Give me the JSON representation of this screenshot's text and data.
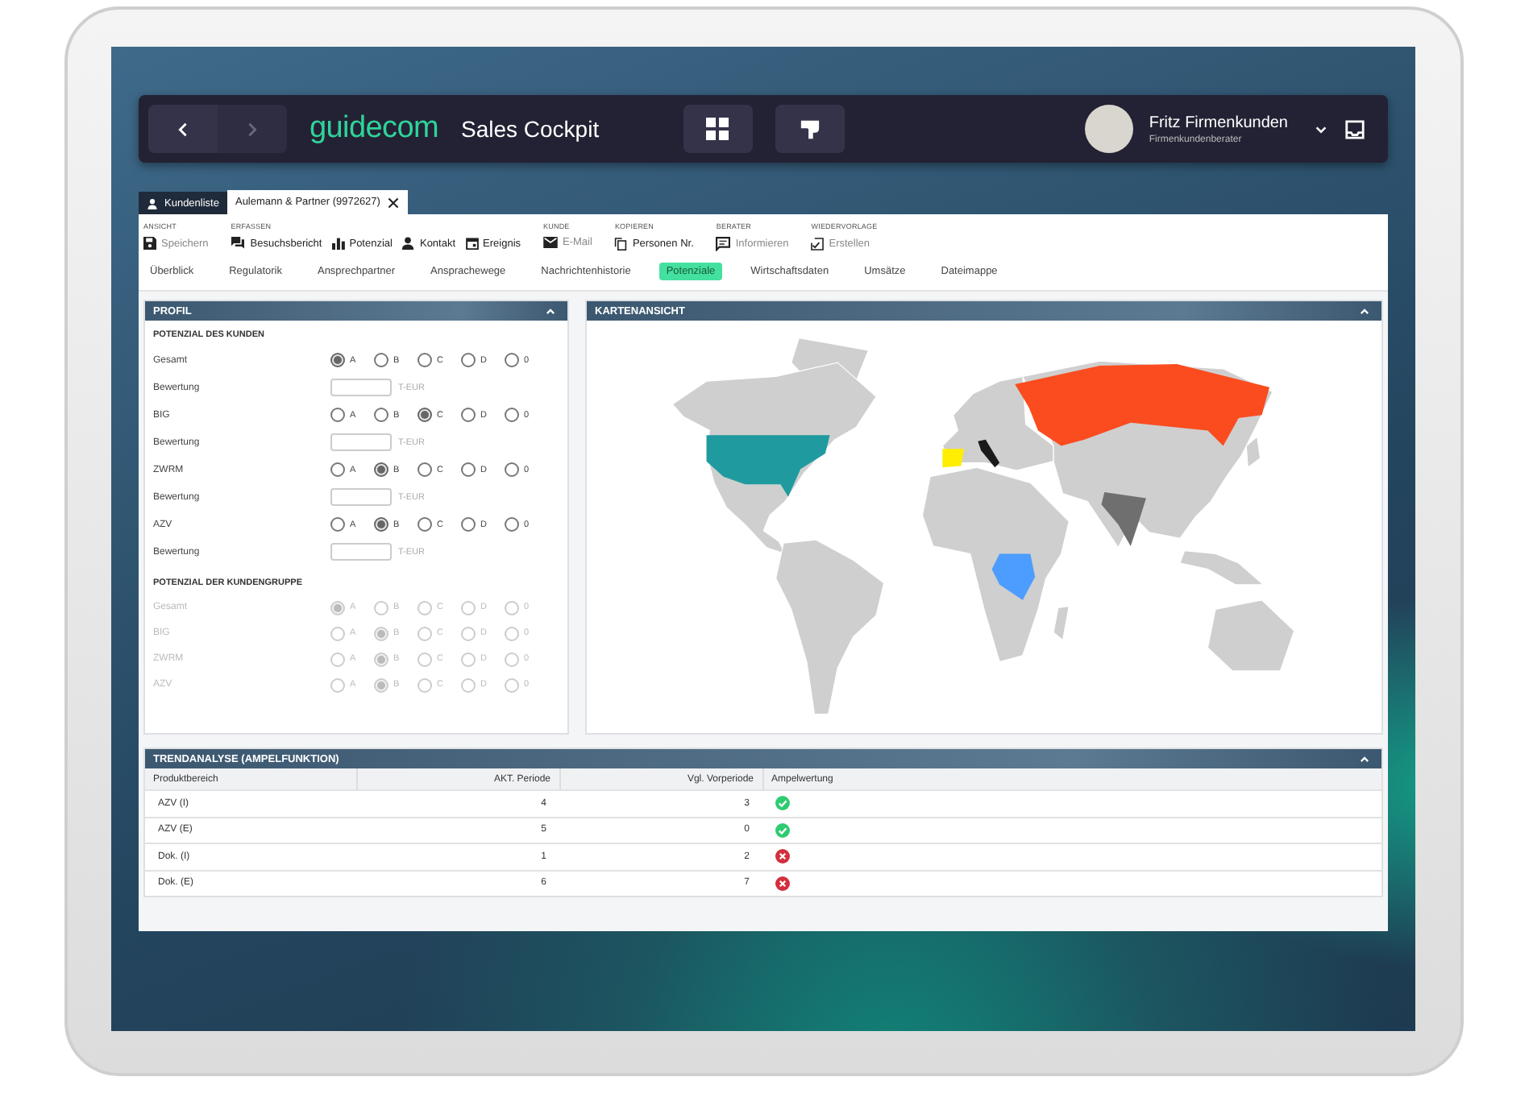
{
  "header": {
    "app_name": "guidecom",
    "app_title": "Sales Cockpit",
    "user": {
      "name": "Fritz Firmenkunden",
      "role": "Firmenkundenberater"
    }
  },
  "document_tabs": [
    {
      "label": "Kundenliste",
      "selected": false,
      "kind": "list"
    },
    {
      "label": "Aulemann & Partner (9972627)",
      "selected": true,
      "kind": "record"
    }
  ],
  "toolbar": [
    {
      "heading": "ANSICHT",
      "actions": [
        {
          "label": "Speichern",
          "disabled": true
        }
      ]
    },
    {
      "heading": "ERFASSEN",
      "actions": [
        {
          "label": "Besuchsbericht",
          "disabled": false
        },
        {
          "label": "Potenzial",
          "disabled": false
        },
        {
          "label": "Kontakt",
          "disabled": false
        },
        {
          "label": "Ereignis",
          "disabled": false
        }
      ]
    },
    {
      "heading": "KUNDE",
      "actions": [
        {
          "label": "E-Mail",
          "disabled": true
        }
      ]
    },
    {
      "heading": "KOPIEREN",
      "actions": [
        {
          "label": "Personen Nr.",
          "disabled": false
        }
      ]
    },
    {
      "heading": "BERATER",
      "actions": [
        {
          "label": "Informieren",
          "disabled": true
        }
      ]
    },
    {
      "heading": "WIEDERVORLAGE",
      "actions": [
        {
          "label": "Erstellen",
          "disabled": true
        }
      ]
    }
  ],
  "nav_tabs": [
    {
      "label": "Überblick",
      "selected": false
    },
    {
      "label": "Regulatorik",
      "selected": false
    },
    {
      "label": "Ansprechpartner",
      "selected": false
    },
    {
      "label": "Ansprachewege",
      "selected": false
    },
    {
      "label": "Nachrichtenhistorie",
      "selected": false
    },
    {
      "label": "Potenziale",
      "selected": true
    },
    {
      "label": "Wirtschaftsdaten",
      "selected": false
    },
    {
      "label": "Umsätze",
      "selected": false
    },
    {
      "label": "Dateimappe",
      "selected": false
    }
  ],
  "profile_panel": {
    "title": "PROFIL",
    "sections": [
      {
        "heading": "POTENZIAL DES KUNDEN",
        "disabled": false,
        "rows": [
          {
            "kind": "radio",
            "label": "Gesamt",
            "options": [
              {
                "label": "A",
                "selected": true
              },
              {
                "label": "B",
                "selected": false
              },
              {
                "label": "C",
                "selected": false
              },
              {
                "label": "D",
                "selected": false
              },
              {
                "label": "0",
                "selected": false
              }
            ]
          },
          {
            "kind": "amount",
            "label": "Bewertung",
            "unit": "T-EUR"
          },
          {
            "kind": "radio",
            "label": "BIG",
            "options": [
              {
                "label": "A",
                "selected": false
              },
              {
                "label": "B",
                "selected": false
              },
              {
                "label": "C",
                "selected": true
              },
              {
                "label": "D",
                "selected": false
              },
              {
                "label": "0",
                "selected": false
              }
            ]
          },
          {
            "kind": "amount",
            "label": "Bewertung",
            "unit": "T-EUR"
          },
          {
            "kind": "radio",
            "label": "ZWRM",
            "options": [
              {
                "label": "A",
                "selected": false
              },
              {
                "label": "B",
                "selected": true
              },
              {
                "label": "C",
                "selected": false
              },
              {
                "label": "D",
                "selected": false
              },
              {
                "label": "0",
                "selected": false
              }
            ]
          },
          {
            "kind": "amount",
            "label": "Bewertung",
            "unit": "T-EUR"
          },
          {
            "kind": "radio",
            "label": "AZV",
            "options": [
              {
                "label": "A",
                "selected": false
              },
              {
                "label": "B",
                "selected": true
              },
              {
                "label": "C",
                "selected": false
              },
              {
                "label": "D",
                "selected": false
              },
              {
                "label": "0",
                "selected": false
              }
            ]
          },
          {
            "kind": "amount",
            "label": "Bewertung",
            "unit": "T-EUR"
          }
        ]
      },
      {
        "heading": "POTENZIAL DER KUNDENGRUPPE",
        "disabled": true,
        "rows": [
          {
            "kind": "radio",
            "label": "Gesamt",
            "options": [
              {
                "label": "A",
                "selected": true
              },
              {
                "label": "B",
                "selected": false
              },
              {
                "label": "C",
                "selected": false
              },
              {
                "label": "D",
                "selected": false
              },
              {
                "label": "0",
                "selected": false
              }
            ]
          },
          {
            "kind": "radio",
            "label": "BIG",
            "options": [
              {
                "label": "A",
                "selected": false
              },
              {
                "label": "B",
                "selected": true
              },
              {
                "label": "C",
                "selected": false
              },
              {
                "label": "D",
                "selected": false
              },
              {
                "label": "0",
                "selected": false
              }
            ]
          },
          {
            "kind": "radio",
            "label": "ZWRM",
            "options": [
              {
                "label": "A",
                "selected": false
              },
              {
                "label": "B",
                "selected": true
              },
              {
                "label": "C",
                "selected": false
              },
              {
                "label": "D",
                "selected": false
              },
              {
                "label": "0",
                "selected": false
              }
            ]
          },
          {
            "kind": "radio",
            "label": "AZV",
            "options": [
              {
                "label": "A",
                "selected": false
              },
              {
                "label": "B",
                "selected": true
              },
              {
                "label": "C",
                "selected": false
              },
              {
                "label": "D",
                "selected": false
              },
              {
                "label": "0",
                "selected": false
              }
            ]
          }
        ]
      }
    ]
  },
  "map_panel": {
    "title": "KARTENANSICHT"
  },
  "trend_panel": {
    "title": "TRENDANALYSE (AMPELFUNKTION)",
    "columns": [
      "Produktbereich",
      "AKT. Periode",
      "Vgl. Vorperiode",
      "Ampelwertung"
    ],
    "rows": [
      {
        "cells": [
          "AZV (I)",
          "4",
          "3"
        ],
        "kind": "positive"
      },
      {
        "cells": [
          "AZV (E)",
          "5",
          "0"
        ],
        "kind": "positive"
      },
      {
        "cells": [
          "Dok. (I)",
          "1",
          "2"
        ],
        "kind": "negative"
      },
      {
        "cells": [
          "Dok. (E)",
          "6",
          "7"
        ],
        "kind": "negative"
      }
    ]
  }
}
